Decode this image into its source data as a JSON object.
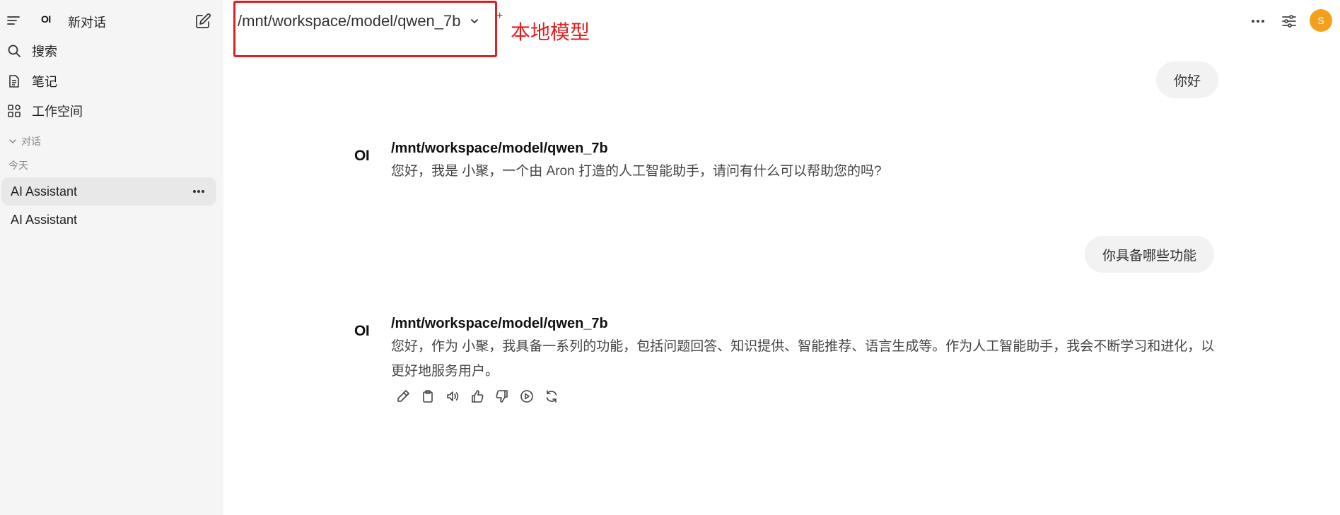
{
  "sidebar": {
    "logo_text": "OI",
    "new_chat_label": "新对话",
    "nav": [
      {
        "label": "搜索",
        "icon": "search-icon"
      },
      {
        "label": "笔记",
        "icon": "notes-icon"
      },
      {
        "label": "工作空间",
        "icon": "workspace-icon"
      }
    ],
    "section_label": "对话",
    "group_label": "今天",
    "chats": [
      {
        "title": "AI Assistant",
        "active": true
      },
      {
        "title": "AI Assistant",
        "active": false
      }
    ]
  },
  "header": {
    "model_name": "/mnt/workspace/model/qwen_7b",
    "plus_label": "+",
    "annotation": "本地模型",
    "avatar_initial": "S"
  },
  "messages": [
    {
      "role": "user",
      "text": "你好"
    },
    {
      "role": "assistant",
      "logo": "OI",
      "model": "/mnt/workspace/model/qwen_7b",
      "text": "您好，我是 小聚，一个由 Aron 打造的人工智能助手，请问有什么可以帮助您的吗?"
    },
    {
      "role": "user",
      "text": "你具备哪些功能"
    },
    {
      "role": "assistant",
      "logo": "OI",
      "model": "/mnt/workspace/model/qwen_7b",
      "text": "您好，作为 小聚，我具备一系列的功能，包括问题回答、知识提供、智能推荐、语言生成等。作为人工智能助手，我会不断学习和进化，以更好地服务用户。"
    }
  ],
  "actions": [
    "edit-icon",
    "copy-icon",
    "speaker-icon",
    "thumbs-up-icon",
    "thumbs-down-icon",
    "play-icon",
    "regenerate-icon"
  ],
  "colors": {
    "sidebar_bg": "#f5f5f5",
    "annotation": "#e02020",
    "avatar": "#f4a01c",
    "bubble": "#f2f2f2"
  }
}
